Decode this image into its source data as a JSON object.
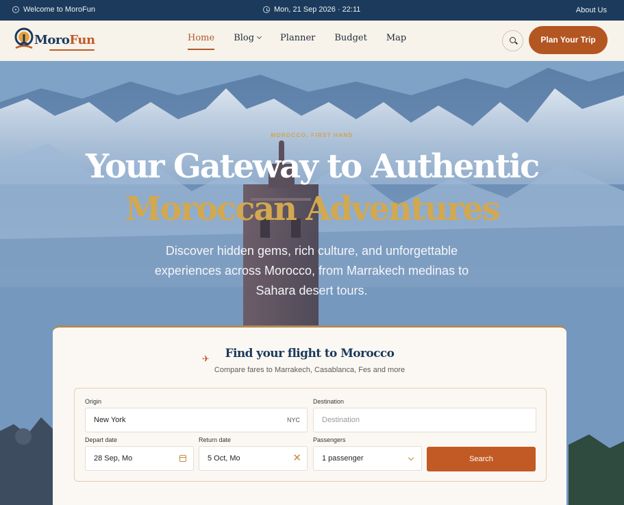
{
  "topbar": {
    "welcome": "Welcome to MoroFun",
    "datetime": "Mon, 21 Sep 2026 · 22:11",
    "about": "About Us"
  },
  "brand": {
    "part1": "Moro",
    "part2": "Fun"
  },
  "nav": {
    "items": [
      {
        "label": "Home",
        "active": true
      },
      {
        "label": "Blog",
        "dropdown": true
      },
      {
        "label": "Planner"
      },
      {
        "label": "Budget"
      },
      {
        "label": "Map"
      }
    ],
    "search_icon": "search-icon",
    "cta": "Plan Your Trip"
  },
  "hero": {
    "eyebrow": "MOROCCO, FIRST HAND",
    "title_line1": "Your Gateway to Authentic",
    "title_line2": "Moroccan Adventures",
    "subtitle": "Discover hidden gems, rich culture, and unforgettable experiences across Morocco, from Marrakech medinas to Sahara desert tours."
  },
  "flight": {
    "title": "Find your flight to Morocco",
    "subtitle": "Compare fares to Marrakech, Casablanca, Fes and more",
    "origin": {
      "label": "Origin",
      "value": "New York",
      "code": "NYC"
    },
    "destination": {
      "label": "Destination",
      "placeholder": "Destination"
    },
    "depart": {
      "label": "Depart date",
      "value": "28 Sep, Mo"
    },
    "return": {
      "label": "Return date",
      "value": "5 Oct, Mo"
    },
    "passengers": {
      "label": "Passengers",
      "value": "1 passenger"
    },
    "search": "Search"
  },
  "colors": {
    "navy": "#1b3a5c",
    "accent": "#c15a25",
    "gold": "#d2a850",
    "cream": "#f7f2ea"
  }
}
